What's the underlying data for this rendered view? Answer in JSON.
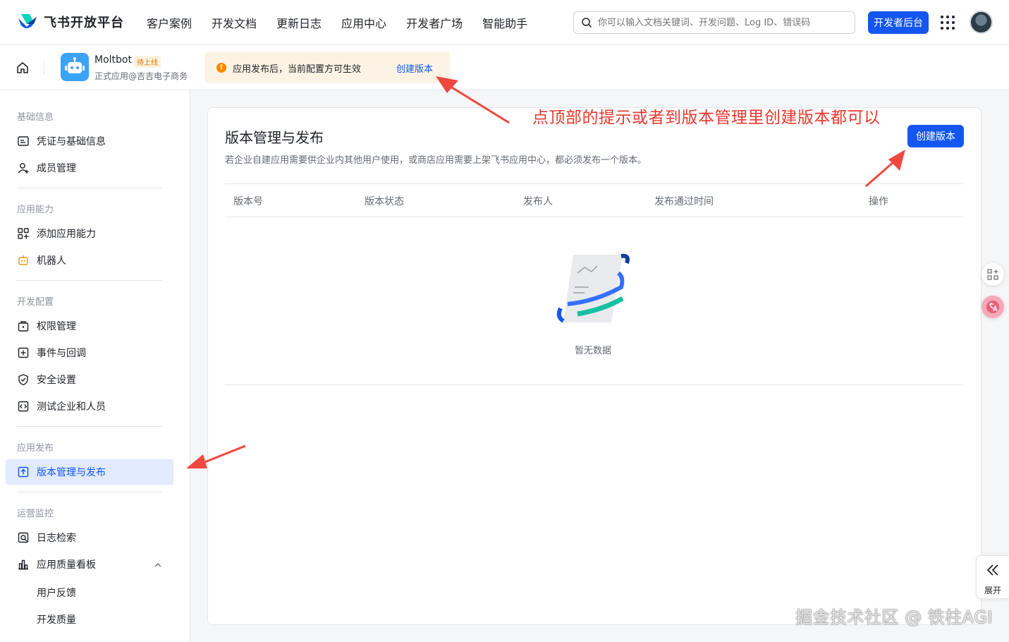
{
  "topnav": {
    "logo_text": "飞书开放平台",
    "items": [
      "客户案例",
      "开发文档",
      "更新日志",
      "应用中心",
      "开发者广场",
      "智能助手"
    ],
    "search_placeholder": "你可以输入文档关键词、开发问题、Log ID、错误码",
    "dev_button": "开发者后台"
  },
  "appbar": {
    "app_name": "Moltbot",
    "badge": "待上线",
    "app_sub": "正式应用@吉吉电子商务",
    "notice_text": "应用发布后，当前配置方可生效",
    "notice_link": "创建版本"
  },
  "sidebar": {
    "sections": [
      {
        "title": "基础信息",
        "items": [
          "凭证与基础信息",
          "成员管理"
        ]
      },
      {
        "title": "应用能力",
        "items": [
          "添加应用能力",
          "机器人"
        ]
      },
      {
        "title": "开发配置",
        "items": [
          "权限管理",
          "事件与回调",
          "安全设置",
          "测试企业和人员"
        ]
      },
      {
        "title": "应用发布",
        "items": [
          "版本管理与发布"
        ]
      },
      {
        "title": "运营监控",
        "items": [
          "日志检索",
          "应用质量看板"
        ]
      }
    ],
    "sub_items": [
      "用户反馈",
      "开发质量"
    ],
    "active": "版本管理与发布"
  },
  "main": {
    "title": "版本管理与发布",
    "description": "若企业自建应用需要供企业内其他用户使用，或商店应用需要上架飞书应用中心，都必须发布一个版本。",
    "create_button": "创建版本",
    "columns": [
      "版本号",
      "版本状态",
      "发布人",
      "发布通过时间",
      "操作"
    ],
    "empty_text": "暂无数据"
  },
  "annotation": "点顶部的提示或者到版本管理里创建版本都可以",
  "floating": {
    "expand_label": "展开"
  },
  "watermark": "掘金技术社区 @ 铁柱AGI",
  "colors": {
    "primary": "#1456f0",
    "annotation": "#e8392f",
    "notice_bg": "#fdf3e4"
  }
}
